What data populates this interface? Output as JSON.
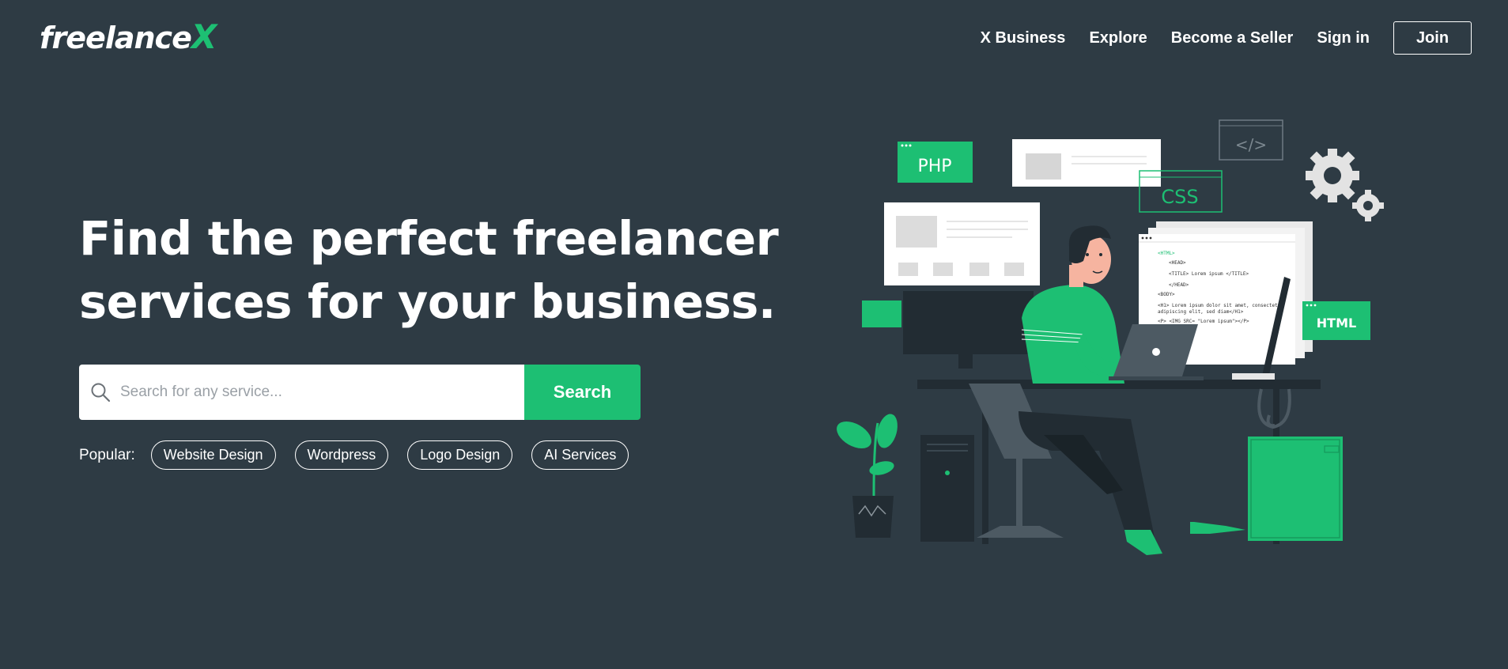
{
  "header": {
    "logo_text": "freelance",
    "logo_accent": "X",
    "nav": [
      {
        "label": "X Business"
      },
      {
        "label": "Explore"
      },
      {
        "label": "Become a Seller"
      },
      {
        "label": "Sign in"
      }
    ],
    "join_label": "Join"
  },
  "hero": {
    "title_line1": "Find the perfect freelancer",
    "title_line2": "services for your business.",
    "search": {
      "placeholder": "Search for any service...",
      "value": "",
      "button_label": "Search"
    },
    "popular_label": "Popular:",
    "popular_tags": [
      {
        "label": "Website Design"
      },
      {
        "label": "Wordpress"
      },
      {
        "label": "Logo Design"
      },
      {
        "label": "AI Services"
      }
    ]
  },
  "illustration": {
    "labels": {
      "php": "PHP",
      "css": "CSS",
      "html": "HTML",
      "code_tag": "</>",
      "code_lines": [
        "<HTML>",
        "<HEAD>",
        "<TITLE> Lorem ipsum </TITLE>",
        "</HEAD>",
        "<BODY>",
        "<H1> Lorem ipsum dolor sit amet, consectetur",
        "adipiscing elit, sed diam</H1>",
        "<P> <IMG SRC= \"Lorem ipsum\"></P>"
      ]
    }
  },
  "colors": {
    "background": "#2e3b44",
    "accent": "#1dbf73",
    "text": "#ffffff"
  },
  "icons": {
    "search": "search-icon"
  }
}
